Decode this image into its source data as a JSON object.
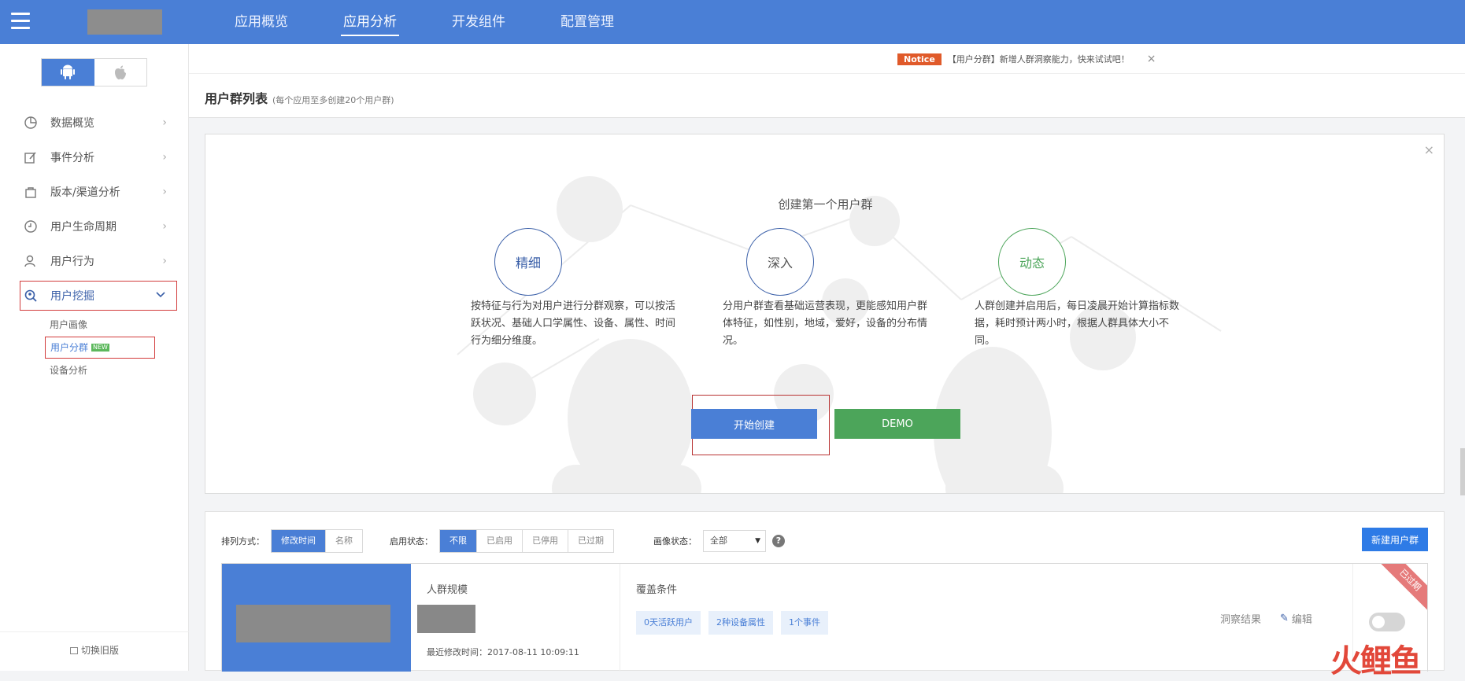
{
  "topnav": {
    "items": [
      "应用概览",
      "应用分析",
      "开发组件",
      "配置管理"
    ],
    "active_index": 1
  },
  "sidebar": {
    "os_options": [
      "android-icon",
      "apple-icon"
    ],
    "items": [
      {
        "label": "数据概览",
        "icon": "pie-chart-icon"
      },
      {
        "label": "事件分析",
        "icon": "edit-icon"
      },
      {
        "label": "版本/渠道分析",
        "icon": "bag-icon"
      },
      {
        "label": "用户生命周期",
        "icon": "clock-icon"
      },
      {
        "label": "用户行为",
        "icon": "user-icon"
      },
      {
        "label": "用户挖掘",
        "icon": "search-user-icon"
      }
    ],
    "submenu": [
      "用户画像",
      "用户分群",
      "设备分析"
    ],
    "new_badge": "NEW",
    "switch_old": "切换旧版"
  },
  "notice": {
    "tag": "Notice",
    "text": "【用户分群】新增人群洞察能力，快来试试吧！",
    "close": "×"
  },
  "page": {
    "title": "用户群列表",
    "subtitle": "(每个应用至多创建20个用户群)"
  },
  "intro": {
    "close": "×",
    "title": "创建第一个用户群",
    "features": [
      {
        "name": "精细",
        "desc": "按特征与行为对用户进行分群观察，可以按活跃状况、基础人口学属性、设备、属性、时间行为细分维度。",
        "color": "#3a5fa8"
      },
      {
        "name": "深入",
        "desc": "分用户群查看基础运营表现，更能感知用户群体特征，如性别，地域，爱好，设备的分布情况。",
        "color": "#555555"
      },
      {
        "name": "动态",
        "desc": "人群创建并启用后，每日凌晨开始计算指标数据，耗时预计两小时，根据人群具体大小不同。",
        "color": "#4ca55a"
      }
    ],
    "start_button": "开始创建",
    "demo_button": "DEMO"
  },
  "filters": {
    "sort_label": "排列方式：",
    "sort_options": [
      "修改时间",
      "名称"
    ],
    "status_label": "启用状态：",
    "status_options": [
      "不限",
      "已启用",
      "已停用",
      "已过期"
    ],
    "portrait_label": "画像状态：",
    "portrait_value": "全部",
    "help": "?",
    "new_group_button": "新建用户群"
  },
  "group": {
    "size_label": "人群规模",
    "modified_time": "最近修改时间：2017-08-11 10:09:11",
    "conditions_label": "覆盖条件",
    "chips": [
      "0天活跃用户",
      "2种设备属性",
      "1个事件"
    ],
    "insight_link": "洞察结果",
    "edit_link": "编辑",
    "ribbon": "已过期"
  },
  "colors": {
    "brand_blue": "#4a7fd6",
    "demo_green": "#4ca55a",
    "highlight_red": "#d23b3b",
    "notice_orange": "#e05a2a"
  }
}
